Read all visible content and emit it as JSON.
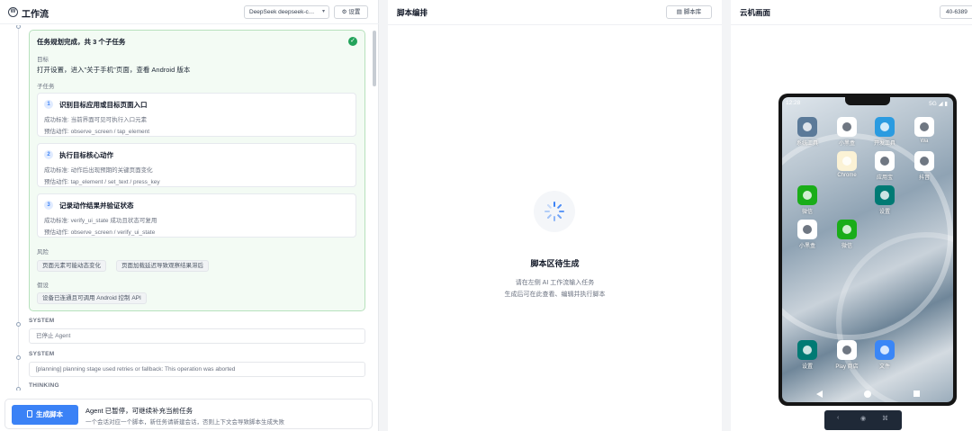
{
  "left_panel": {
    "title": "工作流",
    "model_select": "DeepSeek deepseek-c…",
    "settings_label": "设置",
    "plan": {
      "heading": "任务规划完成，共 3 个子任务",
      "goal_label": "目标",
      "goal": "打开设置，进入\"关于手机\"页面，查看 Android 版本",
      "subtasks_label": "子任务",
      "subtasks": [
        {
          "num": "1",
          "title": "识别目标应用或目标页面入口",
          "criteria": "成功标准: 当前界面可见可执行入口元素",
          "actions": "预估动作: observe_screen / tap_element"
        },
        {
          "num": "2",
          "title": "执行目标核心动作",
          "criteria": "成功标准: 动作后出现预期的关键页面变化",
          "actions": "预估动作: tap_element / set_text / press_key"
        },
        {
          "num": "3",
          "title": "记录动作结果并验证状态",
          "criteria": "成功标准: verify_ui_state 成功且状态可复用",
          "actions": "预估动作: observe_screen / verify_ui_state"
        }
      ],
      "risks_label": "风险",
      "risks": [
        "页面元素可能动态变化",
        "页面加载延迟导致观察结果滞后"
      ],
      "assumptions_label": "假设",
      "assumptions": [
        "设备已连通且可调用 Android 控制 API"
      ]
    },
    "system1_label": "SYSTEM",
    "system1_text": "已停止 Agent",
    "system2_label": "SYSTEM",
    "system2_text": "[planning] planning stage used retries or fallback: This operation was aborted",
    "thinking_label": "THINKING",
    "generate_button": "生成脚本",
    "footer_line1": "Agent 已暂停，可继续补充当前任务",
    "footer_line2": "一个会话对应一个脚本，新任务请新建会话，否则上下文会导致脚本生成失败"
  },
  "middle_panel": {
    "title": "脚本编排",
    "library_button": "脚本库",
    "empty_title": "脚本区待生成",
    "empty_line1": "请在左侧 AI 工作流输入任务",
    "empty_line2": "生成后可在此查看、编辑并执行脚本"
  },
  "right_panel": {
    "title": "云机画面",
    "device_id": "40-6389",
    "status_time": "12:28",
    "status_right": "5G ◢ ▮",
    "apps": [
      {
        "name": "系统工具",
        "icon": "tools-folder-icon",
        "color": "#5b7a99"
      },
      {
        "name": "小黑盒",
        "icon": "heybox-icon",
        "color": "#ffffff"
      },
      {
        "name": "开发工具",
        "icon": "dev-tools-icon",
        "color": "#2b9be0"
      },
      {
        "name": "Wa",
        "icon": "wa-icon",
        "color": "#ffffff"
      },
      {
        "name": "Chrome",
        "icon": "chrome-icon",
        "color": "#fbf2d5"
      },
      {
        "name": "应用宝",
        "icon": "app-store-icon",
        "color": "#ffffff"
      },
      {
        "name": "抖音",
        "icon": "music-icon",
        "color": "#ffffff"
      },
      {
        "name": "微信",
        "icon": "wechat-icon",
        "color": "#1aad19"
      },
      {
        "name": "设置",
        "icon": "settings-icon",
        "color": "#007a74"
      },
      {
        "name": "小黑盒",
        "icon": "heybox-icon",
        "color": "#ffffff"
      },
      {
        "name": "微信",
        "icon": "wechat-icon",
        "color": "#1aad19"
      },
      {
        "name": "设置",
        "icon": "settings-icon",
        "color": "#007a74"
      },
      {
        "name": "Play 商店",
        "icon": "play-store-icon",
        "color": "#ffffff"
      },
      {
        "name": "文件",
        "icon": "files-icon",
        "color": "#3a86f7"
      }
    ],
    "controls": [
      "‹",
      "◉",
      "⌘"
    ]
  }
}
